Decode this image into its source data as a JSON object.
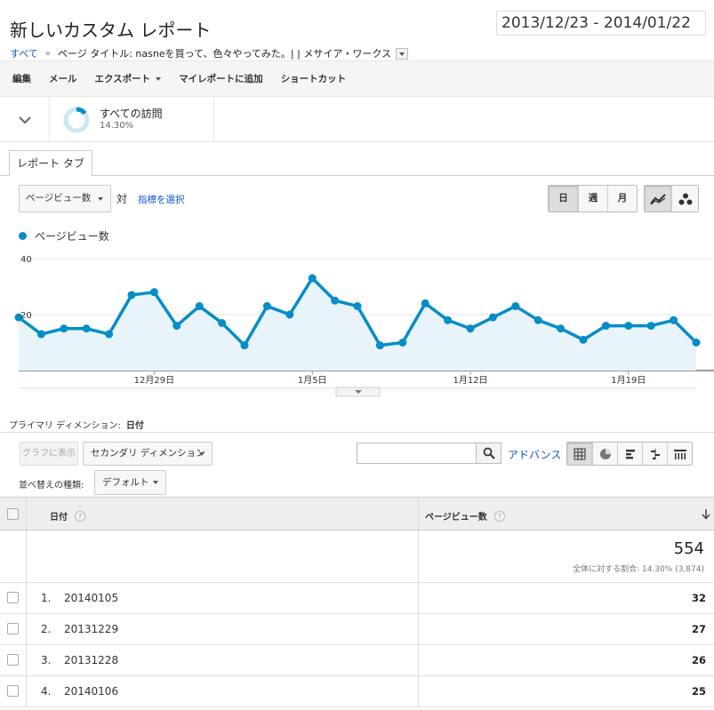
{
  "header": {
    "title": "新しいカスタム レポート",
    "date_range": "2013/12/23 - 2014/01/22"
  },
  "breadcrumb": {
    "all": "すべて",
    "separator": "»",
    "filter": "ページ タイトル: nasneを買って、色々やってみた。| | メサイア・ワークス"
  },
  "toolbar": {
    "edit": "編集",
    "email": "メール",
    "export": "エクスポート",
    "add_to_dashboard": "マイレポートに追加",
    "shortcut": "ショートカット"
  },
  "segment": {
    "name": "すべての訪問",
    "percent": "14.30%",
    "ring_fraction": 0.143
  },
  "report_tab": "レポート タブ",
  "chart_controls": {
    "metric": "ページビュー数",
    "vs": "対",
    "select_metric": "指標を選択",
    "granularity": [
      "日",
      "週",
      "月"
    ],
    "legend": "ページビュー数"
  },
  "chart_data": {
    "type": "area",
    "series": [
      {
        "name": "ページビュー数",
        "values": [
          19,
          13,
          15,
          15,
          13,
          27,
          28,
          16,
          23,
          17,
          9,
          23,
          20,
          33,
          25,
          23,
          9,
          10,
          24,
          18,
          15,
          19,
          23,
          18,
          15,
          11,
          16,
          16,
          16,
          18,
          10
        ]
      }
    ],
    "x_start": "2013/12/23",
    "x_tick_labels": [
      {
        "index": 6,
        "label": "12月29日"
      },
      {
        "index": 13,
        "label": "1月5日"
      },
      {
        "index": 20,
        "label": "1月12日"
      },
      {
        "index": 27,
        "label": "1月19日"
      }
    ],
    "y_tick_labels": [
      20,
      40
    ],
    "ylim": [
      0,
      40
    ],
    "color": "#058dc7",
    "fill_color": "#e8f4fa",
    "grid": true
  },
  "primary_dimension": {
    "label": "プライマリ ディメンション:",
    "value": "日付"
  },
  "table_controls": {
    "plot_rows": "グラフに表示",
    "secondary_dimension": "セカンダリ ディメンション",
    "advanced": "アドバンス",
    "sort_label": "並べ替えの種類:",
    "sort_value": "デフォルト"
  },
  "table": {
    "headers": {
      "dimension": "日付",
      "metric": "ページビュー数",
      "help": "?"
    },
    "summary": {
      "value": "554",
      "percent_text": "全体に対する割合: 14.30% (3,874)"
    },
    "rows": [
      {
        "num": "1.",
        "date": "20140105",
        "value": "32"
      },
      {
        "num": "2.",
        "date": "20131229",
        "value": "27"
      },
      {
        "num": "3.",
        "date": "20131228",
        "value": "26"
      },
      {
        "num": "4.",
        "date": "20140106",
        "value": "25"
      }
    ]
  }
}
